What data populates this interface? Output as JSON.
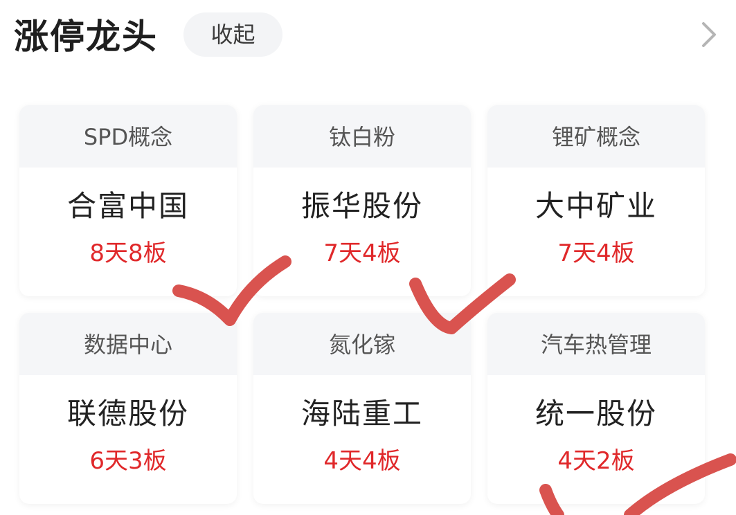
{
  "header": {
    "title": "涨停龙头",
    "collapse_label": "收起"
  },
  "colors": {
    "stat_red": "#e0282a",
    "card_head_bg": "#f5f6f8",
    "ink_mark": "#d9534f"
  },
  "cards": [
    {
      "concept": "SPD概念",
      "stock": "合富中国",
      "stat": "8天8板"
    },
    {
      "concept": "钛白粉",
      "stock": "振华股份",
      "stat": "7天4板"
    },
    {
      "concept": "锂矿概念",
      "stock": "大中矿业",
      "stat": "7天4板"
    },
    {
      "concept": "数据中心",
      "stock": "联德股份",
      "stat": "6天3板"
    },
    {
      "concept": "氮化镓",
      "stock": "海陆重工",
      "stat": "4天4板"
    },
    {
      "concept": "汽车热管理",
      "stock": "统一股份",
      "stat": "4天2板"
    }
  ]
}
